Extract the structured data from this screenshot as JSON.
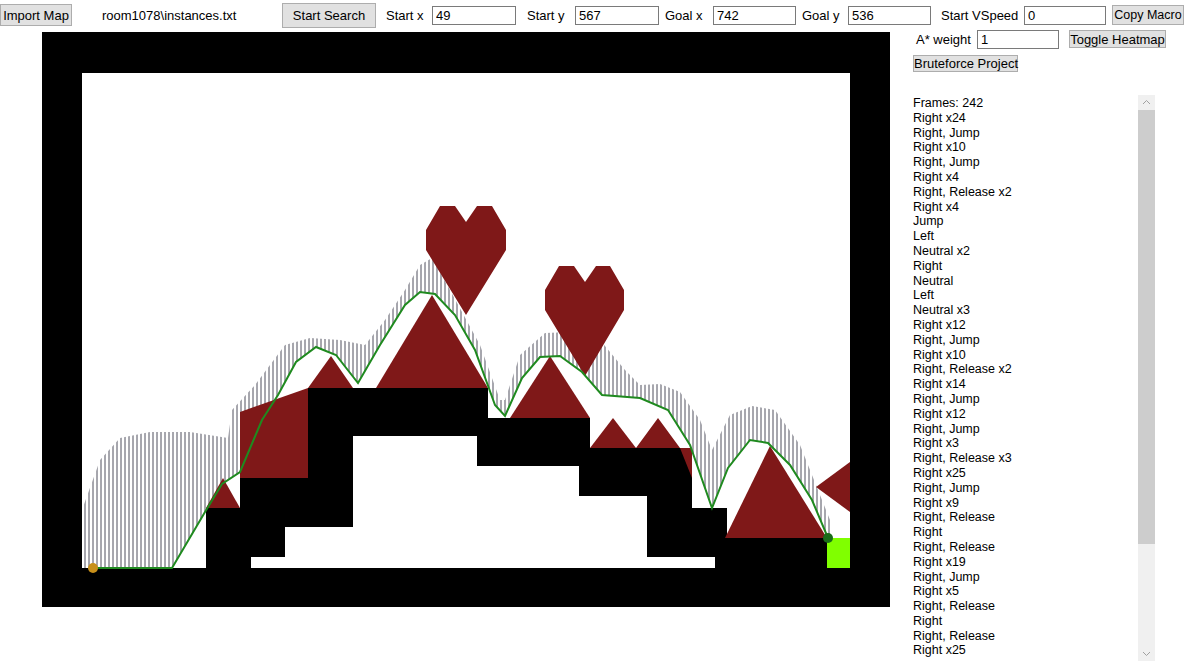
{
  "toolbar": {
    "import_button": "Import Map",
    "file": "room1078\\instances.txt",
    "search_button": "Start Search",
    "fields": [
      {
        "label": "Start x",
        "value": "49"
      },
      {
        "label": "Start y",
        "value": "567"
      },
      {
        "label": "Goal x",
        "value": "742"
      },
      {
        "label": "Goal y",
        "value": "536"
      },
      {
        "label": "Start VSpeed",
        "value": "0"
      }
    ],
    "copy_button": "Copy Macro"
  },
  "options": {
    "weight_label": "A* weight",
    "weight_value": "1",
    "heatmap_button": "Toggle Heatmap",
    "bruteforce_button": "Bruteforce Project"
  },
  "output": {
    "lines": [
      "Frames: 242",
      "Right x24",
      "Right, Jump",
      "Right x10",
      "Right, Jump",
      "Right x4",
      "Right, Release x2",
      "Right x4",
      "Jump",
      "Left",
      "Neutral x2",
      "Right",
      "Neutral",
      "Left",
      "Neutral x3",
      "Right x12",
      "Right, Jump",
      "Right x10",
      "Right, Release x2",
      "Right x14",
      "Right, Jump",
      "Right x12",
      "Right, Jump",
      "Right x3",
      "Right, Release x3",
      "Right x25",
      "Right, Jump",
      "Right x9",
      "Right, Release",
      "Right",
      "Right, Release",
      "Right x19",
      "Right, Jump",
      "Right x5",
      "Right, Release",
      "Right",
      "Right, Release",
      "Right x25"
    ],
    "scrollbar": {
      "level": 0.81
    }
  }
}
